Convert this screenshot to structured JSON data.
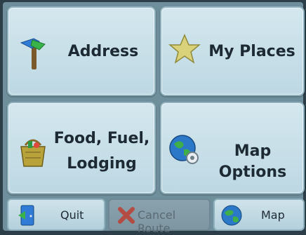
{
  "menu": {
    "address_label": "Address",
    "my_places_label": "My Places",
    "food_line1": "Food, Fuel,",
    "food_line2": "Lodging",
    "map_options_label": "Map Options"
  },
  "bottom_bar": {
    "quit_label": "Quit",
    "cancel_route_label": "Cancel Route",
    "map_label": "Map"
  },
  "icons": {
    "address": "signpost-icon",
    "my_places": "star-icon",
    "food": "shopping-basket-icon",
    "map_options": "globe-gear-icon",
    "quit": "exit-door-icon",
    "cancel_route": "red-x-icon",
    "map": "globe-icon"
  },
  "colors": {
    "tile_bg": "#c9e0e8",
    "border": "#8fb0bd",
    "text": "#1e2a33",
    "disabled_text": "#5a6a72",
    "cancel_x": "#c0392b"
  }
}
